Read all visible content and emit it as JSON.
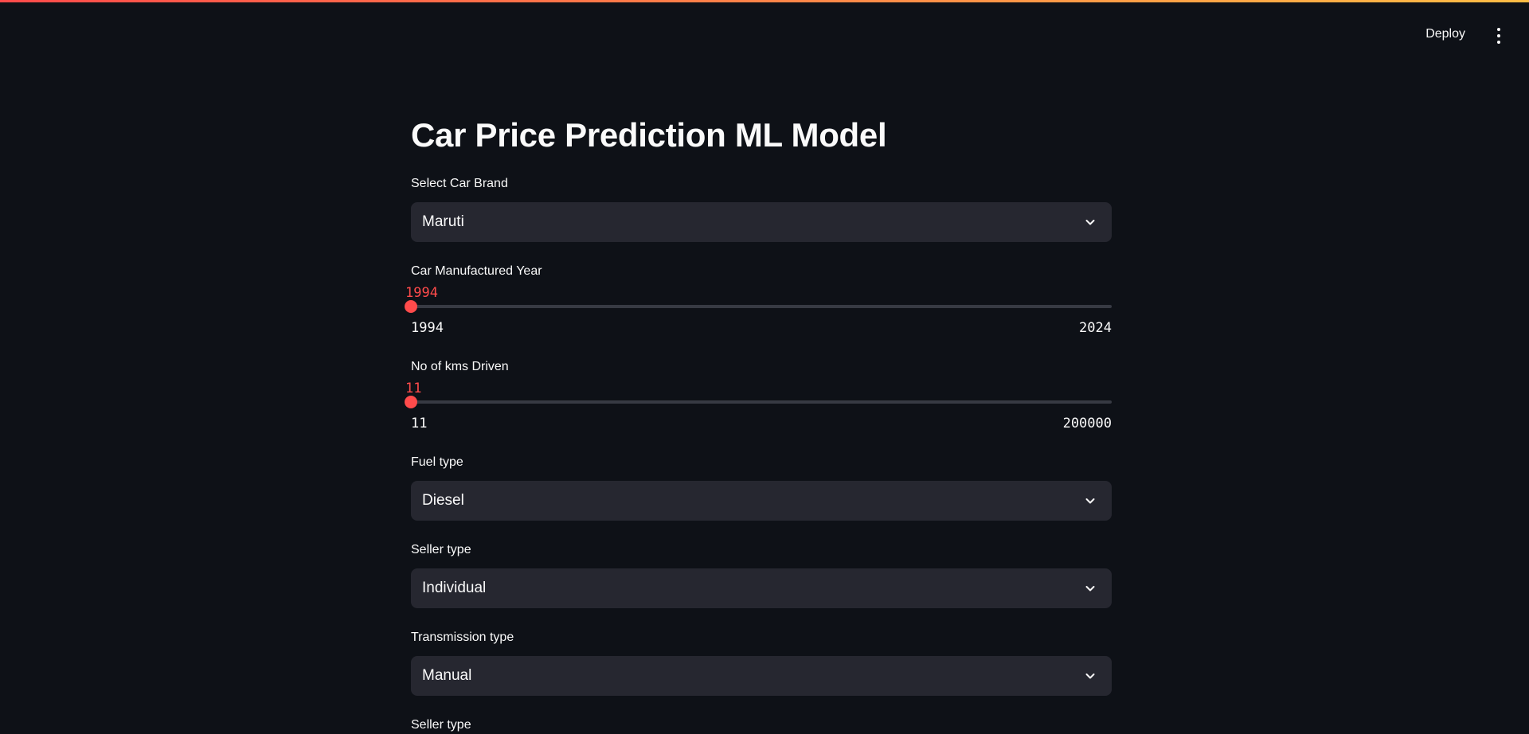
{
  "header": {
    "deploy_label": "Deploy"
  },
  "title": "Car Price Prediction ML Model",
  "brand": {
    "label": "Select Car Brand",
    "value": "Maruti"
  },
  "year": {
    "label": "Car Manufactured Year",
    "value": "1994",
    "min": "1994",
    "max": "2024",
    "fraction": 0
  },
  "kms": {
    "label": "No of kms Driven",
    "value": "11",
    "min": "11",
    "max": "200000",
    "fraction": 0
  },
  "fuel": {
    "label": "Fuel type",
    "value": "Diesel"
  },
  "seller": {
    "label": "Seller type",
    "value": "Individual"
  },
  "transmission": {
    "label": "Transmission type",
    "value": "Manual"
  },
  "seller2": {
    "label": "Seller type"
  },
  "colors": {
    "background": "#0e1117",
    "accent": "#ff4b4b",
    "input_bg": "#262730"
  },
  "icons": {
    "menu": "vertical-ellipsis-icon",
    "dropdown": "chevron-down-icon"
  }
}
